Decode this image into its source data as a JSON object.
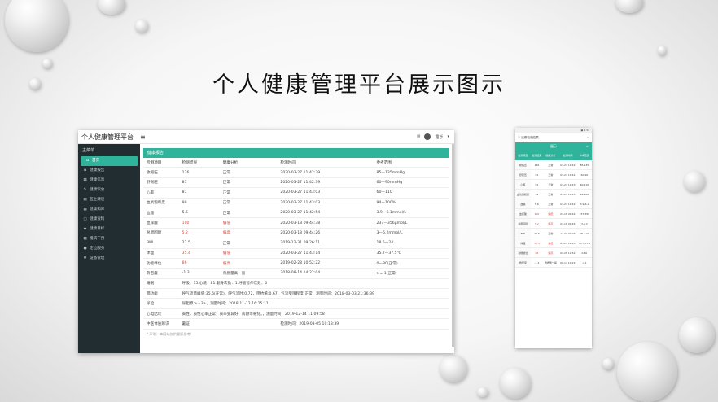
{
  "slide": {
    "title": "个人健康管理平台展示图示"
  },
  "desktop": {
    "brand": "个人健康管理平台",
    "menu_icon": "hamburger-icon",
    "user_name": "露乐",
    "sidebar_header": "主菜单",
    "sidebar": [
      {
        "label": "首页",
        "icon": "home-icon",
        "glyph": "⌂"
      },
      {
        "label": "健康报告",
        "icon": "folder-icon",
        "glyph": "▪"
      },
      {
        "label": "健康信息",
        "icon": "grid-icon",
        "glyph": "▦"
      },
      {
        "label": "健康饮食",
        "icon": "edit-icon",
        "glyph": "✎"
      },
      {
        "label": "医生建议",
        "icon": "file-icon",
        "glyph": "▤"
      },
      {
        "label": "健康知库",
        "icon": "table-icon",
        "glyph": "▦"
      },
      {
        "label": "健康资料",
        "icon": "document-icon",
        "glyph": "▢"
      },
      {
        "label": "健康目标",
        "icon": "target-icon",
        "glyph": "◆"
      },
      {
        "label": "慢病干预",
        "icon": "calendar-icon",
        "glyph": "▦"
      },
      {
        "label": "定位服务",
        "icon": "location-icon",
        "glyph": "●"
      },
      {
        "label": "设备管理",
        "icon": "gear-icon",
        "glyph": "✱"
      }
    ],
    "panel_title": "健康报告",
    "columns": [
      "检测项目",
      "检测结果",
      "健康分析",
      "检测时间",
      "参考范围"
    ],
    "rows": [
      {
        "item": "收缩压",
        "result": "126",
        "analysis": "正常",
        "time": "2020-03-27 11:42:39",
        "ref": "85—135mmHg",
        "abnormal": false
      },
      {
        "item": "舒张压",
        "result": "81",
        "analysis": "正常",
        "time": "2020-03-27 11:42:39",
        "ref": "60—90mmHg",
        "abnormal": false
      },
      {
        "item": "心率",
        "result": "81",
        "analysis": "正常",
        "time": "2020-03-27 11:43:03",
        "ref": "60—110",
        "abnormal": false
      },
      {
        "item": "血氧饱和度",
        "result": "99",
        "analysis": "正常",
        "time": "2020-03-27 11:43:03",
        "ref": "94—100%",
        "abnormal": false
      },
      {
        "item": "血糖",
        "result": "5.6",
        "analysis": "正常",
        "time": "2020-03-27 11:42:54",
        "ref": "3.9—6.1mmol/L",
        "abnormal": false
      },
      {
        "item": "血尿酸",
        "result": "100",
        "analysis": "偏低",
        "time": "2020-03-18 09:44:38",
        "ref": "237—356μmol/L",
        "abnormal": true
      },
      {
        "item": "总胆固醇",
        "result": "5.2",
        "analysis": "偏高",
        "time": "2020-03-18 09:44:26",
        "ref": "3—5.2mmol/L",
        "abnormal": true
      },
      {
        "item": "BMI",
        "result": "22.5",
        "analysis": "正常",
        "time": "2019-12-31 09:26:11",
        "ref": "18.5—24",
        "abnormal": false
      },
      {
        "item": "体温",
        "result": "35.4",
        "analysis": "偏低",
        "time": "2020-03-27 11:43:14",
        "ref": "35.7—37.5℃",
        "abnormal": true
      },
      {
        "item": "功能峰位",
        "result": "86",
        "analysis": "偏高",
        "time": "2019-02-28 10:52:22",
        "ref": "0—80(正常)",
        "abnormal": true
      },
      {
        "item": "骨密度",
        "result": "-1.3",
        "analysis": "骨质量高一般",
        "time": "2018-08-14 14:22:04",
        "ref": ">=-1(正常)",
        "abnormal": false
      }
    ],
    "wide_rows": [
      {
        "item": "睡眠",
        "text": "呼吸：15.心跳：81.翻身次数：1.呼吸暂停次数：0"
      },
      {
        "item": "肺功能",
        "text": "呼气流量峰值:35.6(正常)，呼气流时:0.72，阻抗值:0.67，气流受限程度:正常，测量时间：2018-03-03 21:36:39"
      },
      {
        "item": "尿检",
        "text": "尿胆原:++3+，测量时间：2018-11-12 16:15:11"
      },
      {
        "item": "心电结论",
        "text": "窦性，窦性心率正常；窦率变异好，房颤等被化。，测量时间：2019-12-14 11:09:58"
      },
      {
        "item": "中医体质辨识",
        "text": "暑证",
        "time": "检测时间：2019-03-05 10:18:39"
      }
    ],
    "footer_note": "* 声明：本网站仅供健康参考！"
  },
  "phone": {
    "status": "▣ 5:34",
    "nav_title": "近期检测结果",
    "selector": "展示",
    "columns": [
      "检测项目",
      "检测结果",
      "健康分析",
      "检测时间",
      "参考范围"
    ],
    "rows": [
      [
        "收缩压",
        "126",
        "正常",
        "03-27 11:42",
        "85-135"
      ],
      [
        "舒张压",
        "81",
        "正常",
        "03-27 11:42",
        "60-90"
      ],
      [
        "心率",
        "81",
        "正常",
        "03-27 11:43",
        "60-110"
      ],
      [
        "血氧饱和度",
        "99",
        "正常",
        "03-27 11:43",
        "94-100"
      ],
      [
        "血糖",
        "5.6",
        "正常",
        "03-27 11:42",
        "3.9-6.1"
      ],
      [
        "血尿酸",
        "100",
        "偏低",
        "03-18 09:44",
        "237-356"
      ],
      [
        "总胆固醇",
        "5.2",
        "偏高",
        "03-18 09:44",
        "3-5.2"
      ],
      [
        "BMI",
        "22.5",
        "正常",
        "12-31 09:26",
        "18.5-24"
      ],
      [
        "体温",
        "35.4",
        "偏低",
        "03-27 11:43",
        "35.7-37.5"
      ],
      [
        "功能峰位",
        "86",
        "偏高",
        "02-28 10:52",
        "0-80"
      ],
      [
        "骨密度",
        "-1.3",
        "骨质量一般",
        "08-14 14:22",
        ">-1"
      ]
    ]
  }
}
